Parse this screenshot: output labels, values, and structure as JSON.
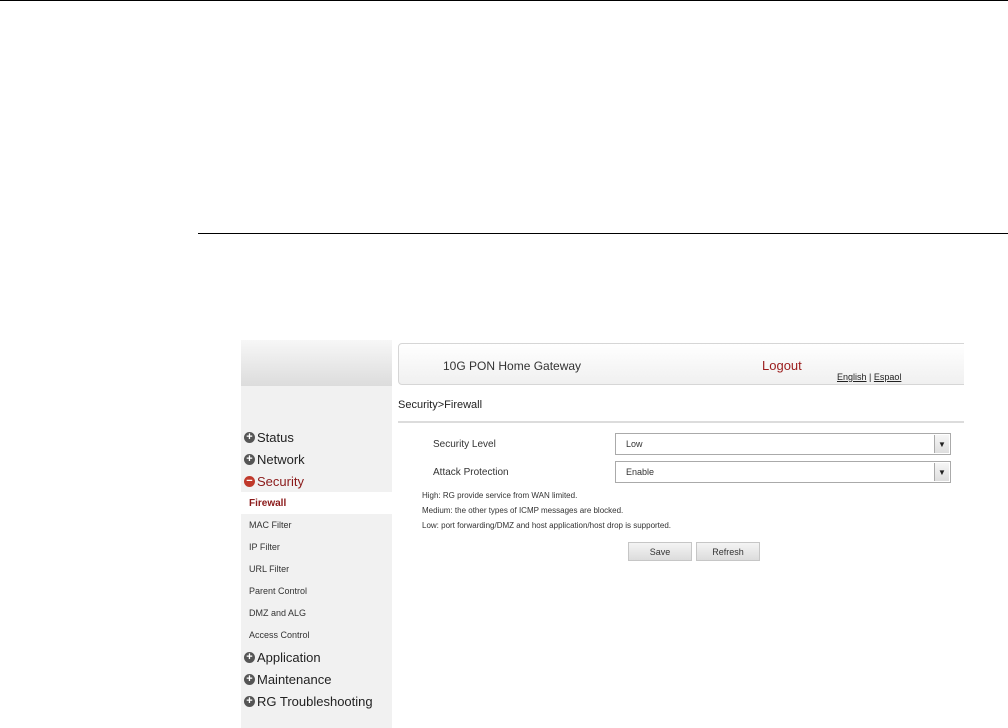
{
  "header": {
    "brand": "10G PON Home Gateway",
    "logout": "Logout",
    "lang_english": "English",
    "lang_sep": " | ",
    "lang_espanol": "Espaol"
  },
  "breadcrumb": "Security>Firewall",
  "sidebar": {
    "items": [
      {
        "label": "Status",
        "expanded": false
      },
      {
        "label": "Network",
        "expanded": false
      },
      {
        "label": "Security",
        "expanded": true,
        "children": [
          "Firewall",
          "MAC Filter",
          "IP Filter",
          "URL Filter",
          "Parent Control",
          "DMZ and ALG",
          "Access Control"
        ],
        "active_child": "Firewall"
      },
      {
        "label": "Application",
        "expanded": false
      },
      {
        "label": "Maintenance",
        "expanded": false
      },
      {
        "label": "RG Troubleshooting",
        "expanded": false
      }
    ]
  },
  "form": {
    "security_level": {
      "label": "Security Level",
      "value": "Low"
    },
    "attack_protection": {
      "label": "Attack Protection",
      "value": "Enable"
    }
  },
  "descriptions": [
    "High: RG provide service from WAN limited.",
    "Medium: the other types of ICMP messages are blocked.",
    "Low: port forwarding/DMZ and host application/host drop is supported."
  ],
  "buttons": {
    "save": "Save",
    "refresh": "Refresh"
  },
  "icons": {
    "collapsed": "plus-circle-icon",
    "expanded": "minus-circle-icon",
    "dropdown": "triangle-down-icon"
  },
  "colors": {
    "accent": "#8b1a1a",
    "logout": "#9b1c1c",
    "sidebar_bg": "#f1f1f1"
  }
}
